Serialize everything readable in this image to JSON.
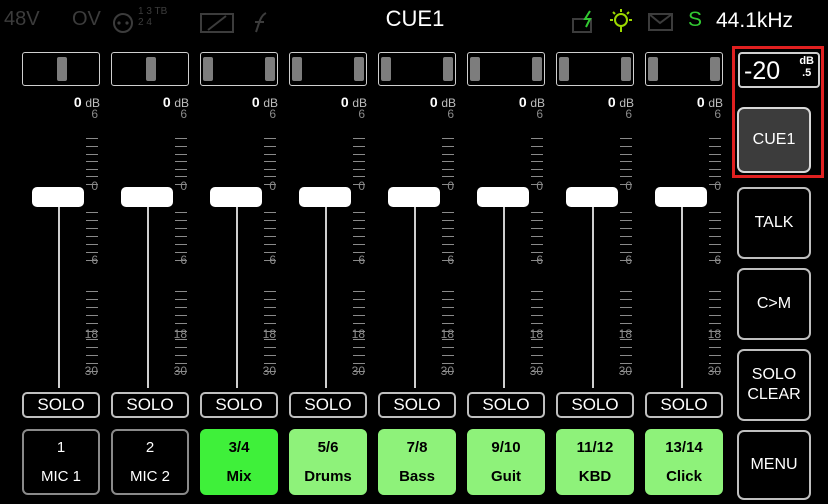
{
  "status_bar": {
    "phantom": "48V",
    "overload": "OV",
    "routing_digits": "1 3 TB\n2 4",
    "title": "CUE1",
    "sync_indicator": "S",
    "sample_rate": "44.1kHz"
  },
  "side_panel": {
    "level_value": "-20",
    "level_unit_top": "dB",
    "level_unit_bottom": ".5",
    "buttons": [
      {
        "label": "CUE1",
        "active": true
      },
      {
        "label": "TALK",
        "active": false
      },
      {
        "label": "C>M",
        "active": false
      },
      {
        "label": "SOLO CLEAR",
        "active": false
      },
      {
        "label": "MENU",
        "active": false
      }
    ]
  },
  "scale_labels": [
    "6",
    "0",
    "6",
    "18",
    "30"
  ],
  "channels": [
    {
      "num": "1",
      "name": "MIC 1",
      "db": "0",
      "unit": "dB",
      "solo": "SOLO",
      "style": "plain"
    },
    {
      "num": "2",
      "name": "MIC 2",
      "db": "0",
      "unit": "dB",
      "solo": "SOLO",
      "style": "plain"
    },
    {
      "num": "3/4",
      "name": "Mix",
      "db": "0",
      "unit": "dB",
      "solo": "SOLO",
      "style": "bright"
    },
    {
      "num": "5/6",
      "name": "Drums",
      "db": "0",
      "unit": "dB",
      "solo": "SOLO",
      "style": "green"
    },
    {
      "num": "7/8",
      "name": "Bass",
      "db": "0",
      "unit": "dB",
      "solo": "SOLO",
      "style": "green"
    },
    {
      "num": "9/10",
      "name": "Guit",
      "db": "0",
      "unit": "dB",
      "solo": "SOLO",
      "style": "green"
    },
    {
      "num": "11/12",
      "name": "KBD",
      "db": "0",
      "unit": "dB",
      "solo": "SOLO",
      "style": "green"
    },
    {
      "num": "13/14",
      "name": "Click",
      "db": "0",
      "unit": "dB",
      "solo": "SOLO",
      "style": "green"
    }
  ],
  "colors": {
    "accent_green": "#8ef27a",
    "active_green": "#3ff03a",
    "highlight_red": "#e02020",
    "sync_green": "#32c832"
  }
}
